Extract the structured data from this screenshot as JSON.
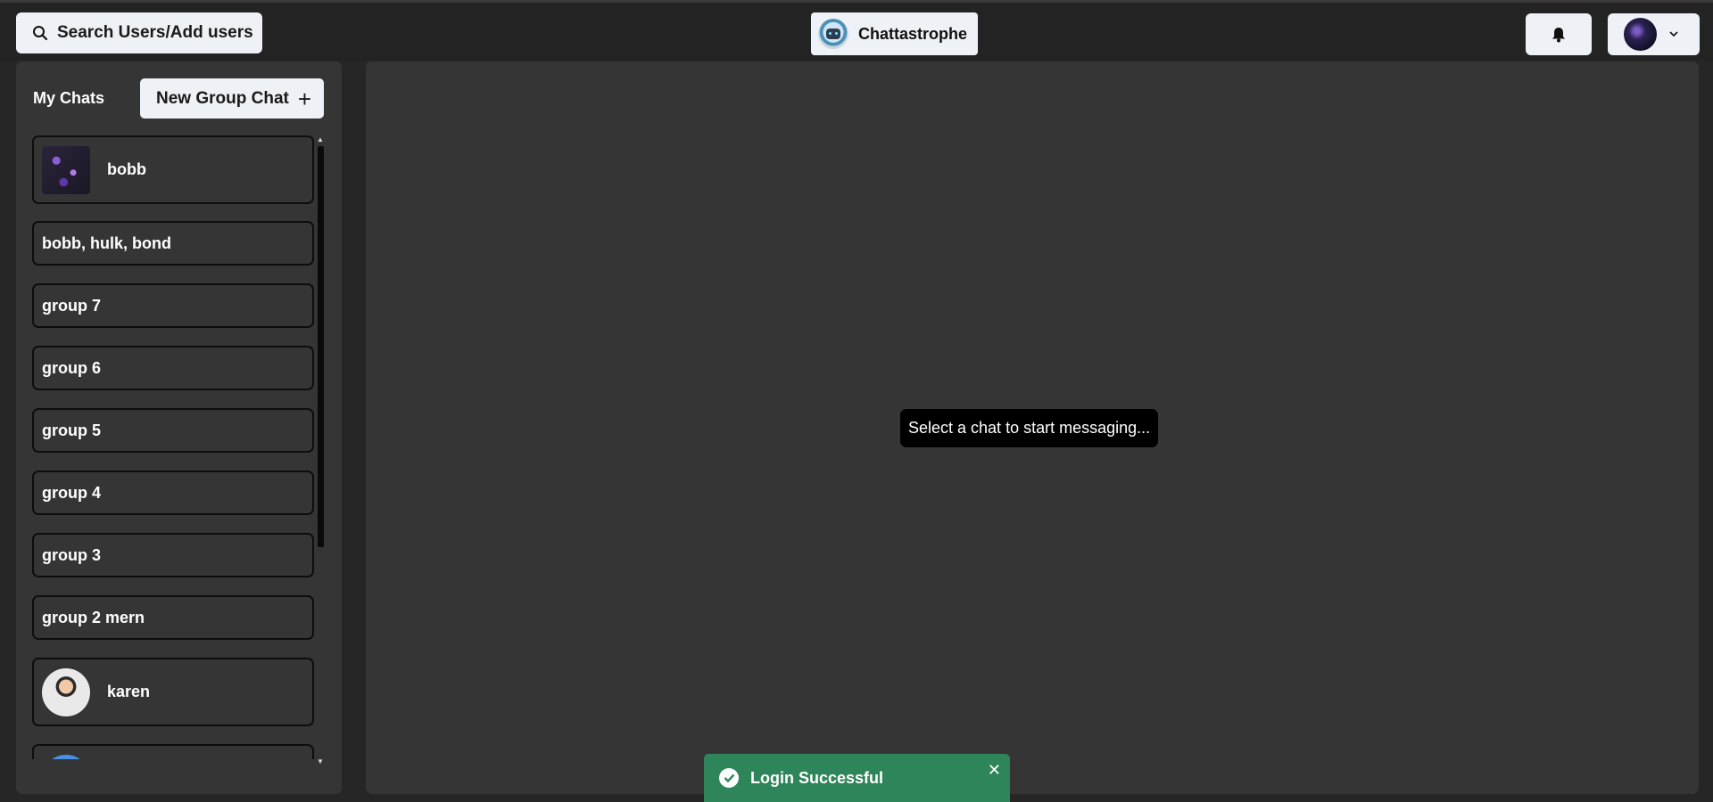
{
  "header": {
    "search_label": "Search Users/Add users",
    "brand_name": "Chattastrophe",
    "icons": {
      "search": "search-icon",
      "bell": "bell-icon",
      "profile_menu": "chevron-down-icon"
    }
  },
  "sidebar": {
    "title": "My Chats",
    "new_group_label": "New Group Chat",
    "new_group_icon": "+",
    "chats": [
      {
        "name": "bobb",
        "avatar": "photo"
      },
      {
        "name": "bobb, hulk, bond"
      },
      {
        "name": "group 7"
      },
      {
        "name": "group 6"
      },
      {
        "name": "group 5"
      },
      {
        "name": "group 4"
      },
      {
        "name": "group 3"
      },
      {
        "name": "group 2 mern"
      },
      {
        "name": "karen",
        "avatar": "photo"
      }
    ]
  },
  "main": {
    "placeholder": "Select a chat to start messaging..."
  },
  "toast": {
    "message": "Login Successful",
    "close_glyph": "✕",
    "color": "#2f855a"
  },
  "colors": {
    "background": "#262626",
    "panel": "#353535",
    "button": "#eef1f5"
  }
}
